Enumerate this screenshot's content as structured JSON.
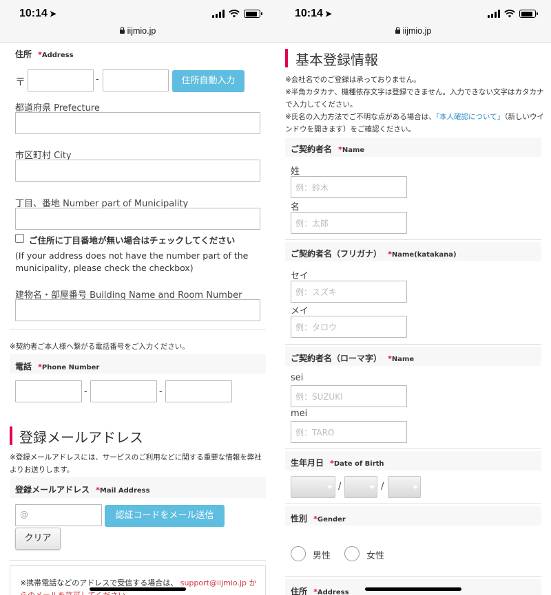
{
  "status_bar": {
    "time": "10:14",
    "url": "iijmio.jp"
  },
  "left": {
    "address": {
      "label": "住所",
      "required": "*",
      "label_en": "Address",
      "postal_mark": "〒",
      "postal_sep": "-",
      "auto_button": "住所自動入力",
      "prefecture_label": "都道府県 Prefecture",
      "city_label": "市区町村 City",
      "number_label": "丁目、番地 Number part of Municipality",
      "no_number_check": "ご住所に丁目番地が無い場合はチェックしてください",
      "no_number_note": "(If your address does not have the number part of the municipality, please check the checkbox)",
      "building_label": "建物名・部屋番号 Building Name and Room Number"
    },
    "phone": {
      "note": "※契約者ご本人様へ繋がる電話番号をご入力ください。",
      "label": "電話",
      "required": "*",
      "label_en": "Phone Number",
      "sep": "-"
    },
    "mail_heading": "登録メールアドレス",
    "mail_note": "※登録メールアドレスには、サービスのご利用などに関する重要な情報を弊社よりお送りします。",
    "mail": {
      "label": "登録メールアドレス",
      "required": "*",
      "label_en": "Mail Address",
      "placeholder": "@",
      "send_button": "認証コードをメール送信",
      "clear_button": "クリア"
    },
    "box_note_prefix": "※携帯電話などのアドレスで受信する場合は、",
    "box_note_email": "support@iijmio.jp",
    "box_note_suffix": "からのメールを許可してください。"
  },
  "right": {
    "heading": "基本登録情報",
    "notes": [
      "※会社名でのご登録は承っておりません。",
      "※半角カタカナ、機種依存文字は登録できません。入力できない文字はカタカナで入力してください。"
    ],
    "note3_prefix": "※氏名の入力方法でご不明な点がある場合は、",
    "note3_link": "「本人確認について」",
    "note3_suffix": "（新しいウインドウを開きます）をご確認ください。",
    "name": {
      "label": "ご契約者名",
      "required": "*",
      "label_en": "Name",
      "sei_label": "姓",
      "sei_placeholder": "例：鈴木",
      "mei_label": "名",
      "mei_placeholder": "例：太郎"
    },
    "kana": {
      "label": "ご契約者名（フリガナ）",
      "required": "*",
      "label_en": "Name(katakana)",
      "sei_label": "セイ",
      "sei_placeholder": "例：スズキ",
      "mei_label": "メイ",
      "mei_placeholder": "例：タロウ"
    },
    "roman": {
      "label": "ご契約者名（ローマ字）",
      "required": "*",
      "label_en": "Name",
      "sei_label": "sei",
      "sei_placeholder": "例：SUZUKI",
      "mei_label": "mei",
      "mei_placeholder": "例：TARO"
    },
    "dob": {
      "label": "生年月日",
      "required": "*",
      "label_en": "Date of Birth",
      "sep": "/"
    },
    "gender": {
      "label": "性別",
      "required": "*",
      "label_en": "Gender",
      "male": "男性",
      "female": "女性"
    },
    "address": {
      "label": "住所",
      "required": "*",
      "label_en": "Address"
    }
  }
}
